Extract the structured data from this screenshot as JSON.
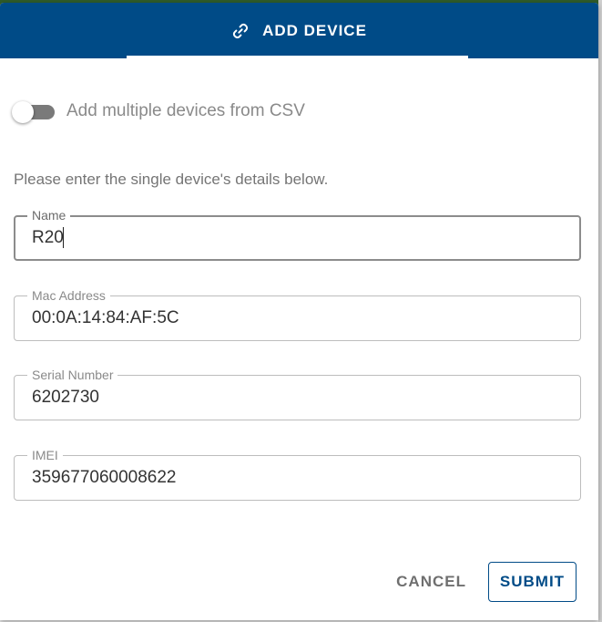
{
  "dialog": {
    "title": "ADD DEVICE",
    "title_icon": "link-icon",
    "colors": {
      "header_bg": "#004b87",
      "header_text": "#ffffff",
      "accent": "#004b87"
    }
  },
  "csv_toggle": {
    "label": "Add multiple devices from CSV",
    "checked": false
  },
  "instruction": "Please enter the single device's details below.",
  "fields": {
    "name": {
      "label": "Name",
      "value": "R20"
    },
    "mac_address": {
      "label": "Mac Address",
      "value": "00:0A:14:84:AF:5C"
    },
    "serial_number": {
      "label": "Serial Number",
      "value": "6202730"
    },
    "imei": {
      "label": "IMEI",
      "value": "359677060008622"
    }
  },
  "actions": {
    "cancel_label": "CANCEL",
    "submit_label": "SUBMIT"
  }
}
